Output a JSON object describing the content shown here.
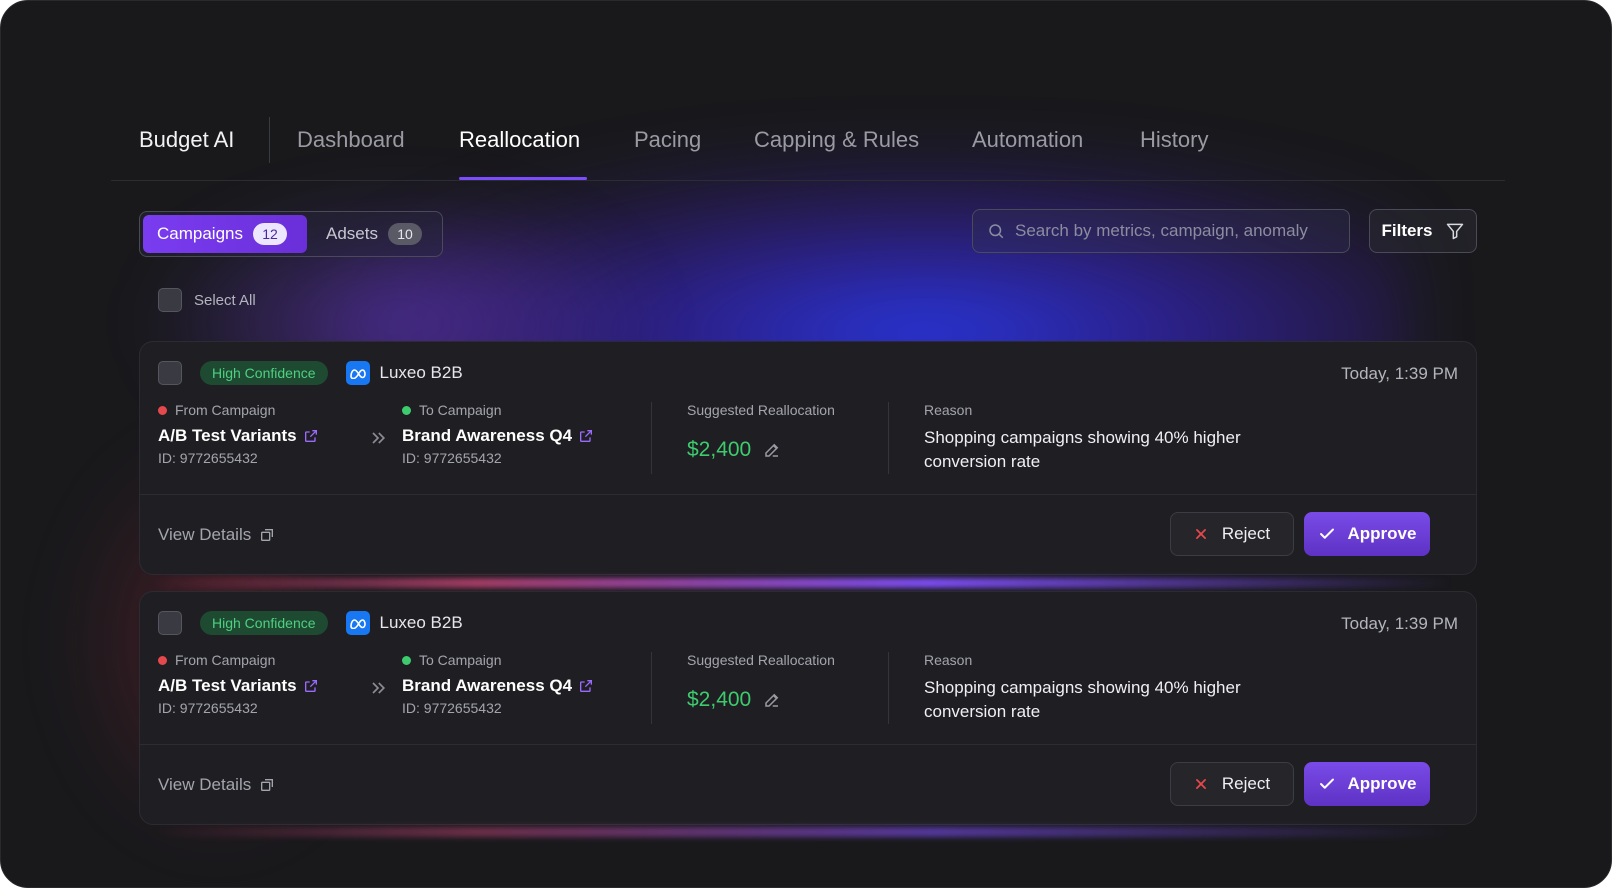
{
  "nav": {
    "brand": "Budget AI",
    "tabs": [
      {
        "label": "Dashboard"
      },
      {
        "label": "Reallocation"
      },
      {
        "label": "Pacing"
      },
      {
        "label": "Capping & Rules"
      },
      {
        "label": "Automation"
      },
      {
        "label": "History"
      }
    ],
    "active_tab": "Reallocation"
  },
  "segment": {
    "campaigns_label": "Campaigns",
    "campaigns_count": "12",
    "adsets_label": "Adsets",
    "adsets_count": "10"
  },
  "search": {
    "placeholder": "Search by metrics, campaign, anomaly"
  },
  "filters": {
    "label": "Filters"
  },
  "select_all": {
    "label": "Select All"
  },
  "cards": [
    {
      "badge": "High Confidence",
      "account": "Luxeo B2B",
      "timestamp": "Today, 1:39 PM",
      "from_label": "From Campaign",
      "from_name": "A/B Test Variants",
      "from_id": "ID: 9772655432",
      "to_label": "To Campaign",
      "to_name": "Brand Awareness Q4",
      "to_id": "ID: 9772655432",
      "suggested_label": "Suggested Reallocation",
      "amount": "$2,400",
      "reason_label": "Reason",
      "reason": "Shopping campaigns showing 40% higher conversion rate",
      "view_details": "View Details",
      "reject": "Reject",
      "approve": "Approve"
    },
    {
      "badge": "High Confidence",
      "account": "Luxeo B2B",
      "timestamp": "Today, 1:39 PM",
      "from_label": "From Campaign",
      "from_name": "A/B Test Variants",
      "from_id": "ID: 9772655432",
      "to_label": "To Campaign",
      "to_name": "Brand Awareness Q4",
      "to_id": "ID: 9772655432",
      "suggested_label": "Suggested Reallocation",
      "amount": "$2,400",
      "reason_label": "Reason",
      "reason": "Shopping campaigns showing 40% higher conversion rate",
      "view_details": "View Details",
      "reject": "Reject",
      "approve": "Approve"
    }
  ],
  "colors": {
    "accent": "#7c4dff",
    "success": "#3ecb6e",
    "danger": "#e5484d",
    "meta_blue": "#1877f2"
  },
  "icons": {
    "search": "search-icon",
    "filter": "filter-icon",
    "external_link": "external-link-icon",
    "chevrons_right": "chevrons-right-icon",
    "pencil": "pencil-icon",
    "close": "close-icon",
    "check": "check-icon",
    "meta_logo": "meta-logo-icon"
  }
}
